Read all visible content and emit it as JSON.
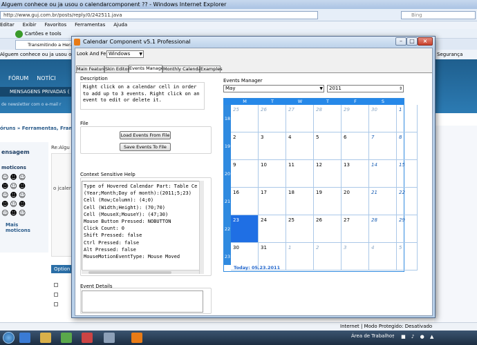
{
  "ie": {
    "title": "Alguem conhece ou ja usou o calendarcomponent ?? - Windows Internet Explorer",
    "url": "http://www.guj.com.br/posts/reply/0/242511.java",
    "search_placeholder": "Bing",
    "menu": [
      "Editar",
      "Exibir",
      "Favoritos",
      "Ferramentas",
      "Ajuda"
    ],
    "fav_item": "Cartões e tools",
    "tab_label": "Transmitindo a Heran",
    "cmd_left": "Alguem conhece ou ja usou o calendarcomponent",
    "cmd_right": "Segurança",
    "status_zone": "Internet | Modo Protegido: Desativado"
  },
  "site": {
    "nav1": "FÓRUM",
    "nav1b": "NOTÍCI",
    "nav2": "MENSAGENS PRIVADAS (",
    "sub": "de newsletter com o e-mail r",
    "crumb": "óruns » Ferramentas, Fram",
    "left_title": "ensagem",
    "emoticons": "moticons",
    "mais": "Mais",
    "mais2": "moticons",
    "re": "Re:Algu",
    "opt": "Option",
    "content_text": "o jcaler"
  },
  "taskbar": {
    "desktop": "Área de Trabalho",
    "tray": "↑ ■ ♪ ● ▲"
  },
  "app": {
    "title": "Calendar Component v5.1 Professional",
    "look_feel_label": "Look And Feel:",
    "look_feel_value": "Windows",
    "tabs": [
      "Main Features",
      "Skin Editor",
      "Events Manager",
      "Monthly Calendar",
      "Examples"
    ],
    "active_tab": "Events Manager",
    "description_title": "Description",
    "description_text": "Right click on a calendar cell in order to add up to 3 events. Right click on an event to edit or delete it.",
    "file_title": "File",
    "load_btn": "Load Events From File",
    "save_btn": "Save Events To File",
    "help_title": "Context Sensitive Help",
    "help_lines": [
      "Type of Hovered Calendar Part: Table Ce",
      "(Year;Month;Day of month):(2011;5;23)",
      "Cell (Row;Column): (4;0)",
      "Cell (Width;Height): (70;70)",
      "Cell (MouseX;MouseY): (47;30)",
      "Mouse Button Pressed: NOBUTTON",
      "Click Count: 0",
      "Shift Pressed: false",
      "Ctrl Pressed: false",
      "Alt Pressed: false",
      "MouseMotionEventType: Mouse Moved"
    ],
    "details_title": "Event Details",
    "events_title": "Events Manager",
    "month": "May",
    "year": "2011",
    "weekdays": [
      "M",
      "T",
      "W",
      "T",
      "F",
      "S",
      "S"
    ],
    "week_numbers": [
      "18",
      "19",
      "20",
      "21",
      "22",
      "23"
    ],
    "days": [
      [
        "25",
        "26",
        "27",
        "28",
        "29",
        "30",
        "1"
      ],
      [
        "2",
        "3",
        "4",
        "5",
        "6",
        "7",
        "8"
      ],
      [
        "9",
        "10",
        "11",
        "12",
        "13",
        "14",
        "15"
      ],
      [
        "16",
        "17",
        "18",
        "19",
        "20",
        "21",
        "22"
      ],
      [
        "23",
        "24",
        "25",
        "26",
        "27",
        "28",
        "29"
      ],
      [
        "30",
        "31",
        "1",
        "2",
        "3",
        "4",
        "5"
      ]
    ],
    "other_month_first_row": 6,
    "other_month_last_row_from": 2,
    "selected_day": "23",
    "today_label": "Today: 05.23.2011",
    "colors": {
      "header": "#2688e8",
      "selected": "#1f6fe4",
      "weekend_text": "#1a5fb4"
    }
  }
}
